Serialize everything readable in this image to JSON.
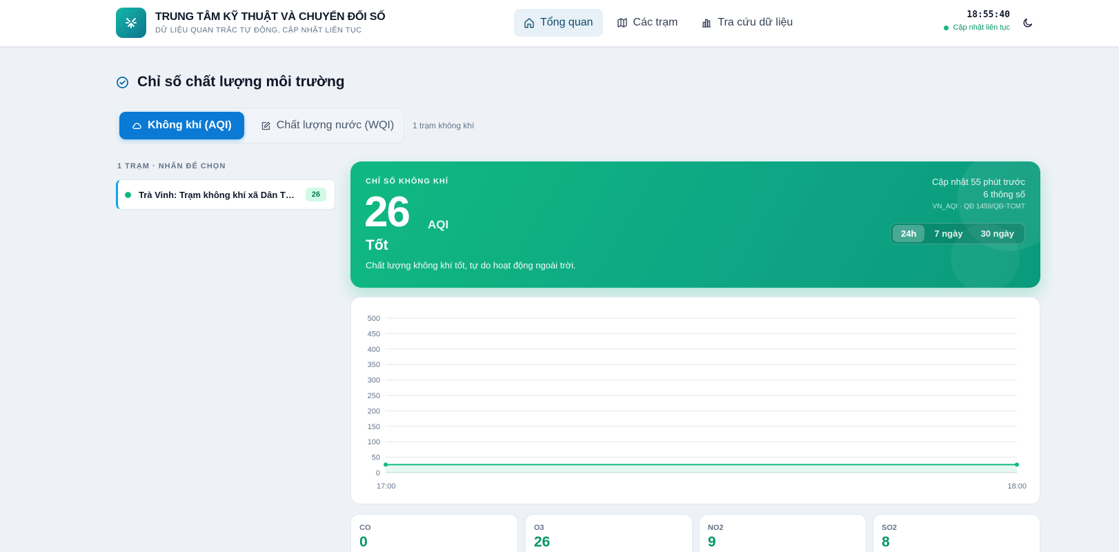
{
  "header": {
    "title": "TRUNG TÂM KỸ THUẬT VÀ CHUYỂN ĐỔI SỐ",
    "subtitle": "DỮ LIỆU QUAN TRẮC TỰ ĐỘNG, CẬP NHẬT LIÊN TỤC",
    "nav": [
      {
        "label": "Tổng quan",
        "icon": "home-icon",
        "active": true
      },
      {
        "label": "Các trạm",
        "icon": "map-icon",
        "active": false
      },
      {
        "label": "Tra cứu dữ liệu",
        "icon": "bar-chart-icon",
        "active": false
      }
    ],
    "clock": "18:55:40",
    "live_status": "Cập nhật liên tục"
  },
  "page": {
    "title": "Chỉ số chất lượng môi trường"
  },
  "tabs": [
    {
      "label": "Không khí (AQI)",
      "icon": "cloud-icon",
      "active": true
    },
    {
      "label": "Chất lượng nước (WQI)",
      "icon": "edit-icon",
      "active": false
    }
  ],
  "tab_note": "1 trạm không khí",
  "stations": {
    "label": "1 TRẠM · NHẤN ĐỂ CHỌN",
    "items": [
      {
        "name": "Trà Vinh: Trạm không khí xã Dân Thành",
        "aqi": "26"
      }
    ]
  },
  "aqi": {
    "kicker": "CHỈ SỐ KHÔNG KHÍ",
    "value": "26",
    "unit": "AQI",
    "level": "Tốt",
    "description": "Chất lượng không khí tốt, tự do hoạt động ngoài trời.",
    "updated": "Cập nhật 55 phút trước",
    "params": "6 thông số",
    "standard": "VN_AQI · QĐ 1459/QĐ-TCMT",
    "ranges": [
      {
        "label": "24h",
        "active": true
      },
      {
        "label": "7 ngày",
        "active": false
      },
      {
        "label": "30 ngày",
        "active": false
      }
    ],
    "color": "#10b981"
  },
  "chart_data": {
    "type": "line",
    "x": [
      "17:00",
      "18:00"
    ],
    "series": [
      {
        "values": [
          26,
          26
        ],
        "color": "#10b981"
      }
    ],
    "ylim": [
      0,
      500
    ],
    "yticks": [
      0,
      50,
      100,
      150,
      200,
      250,
      300,
      350,
      400,
      450,
      500
    ],
    "grid": true
  },
  "metrics": [
    {
      "label": "CO",
      "value": "0"
    },
    {
      "label": "O3",
      "value": "26"
    },
    {
      "label": "NO2",
      "value": "9"
    },
    {
      "label": "SO2",
      "value": "8"
    }
  ]
}
